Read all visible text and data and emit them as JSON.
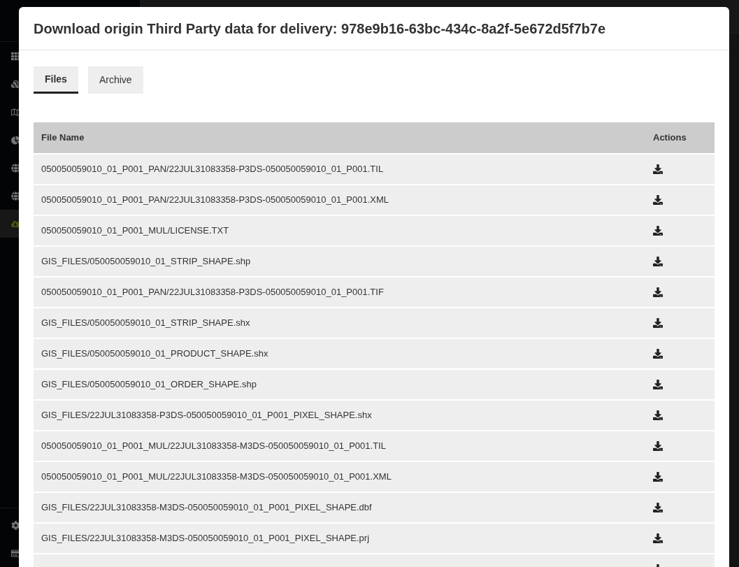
{
  "sidebar": {
    "items": [
      {
        "kind": "grid",
        "selected": false
      },
      {
        "kind": "cubes",
        "selected": false
      },
      {
        "kind": "map",
        "selected": false
      },
      {
        "kind": "pie",
        "selected": false
      },
      {
        "kind": "globe",
        "selected": false
      },
      {
        "kind": "globe",
        "selected": false
      },
      {
        "kind": "download",
        "selected": true
      }
    ],
    "bottom_items": [
      {
        "kind": "settings"
      },
      {
        "kind": "card"
      }
    ]
  },
  "modal": {
    "title": "Download origin Third Party data for delivery: 978e9b16-63bc-434c-8a2f-5e672d5f7b7e",
    "tabs": [
      {
        "label": "Files",
        "selected": true
      },
      {
        "label": "Archive",
        "selected": false
      }
    ],
    "table": {
      "columns": [
        "File Name",
        "Actions"
      ],
      "rows": [
        {
          "file_name": "050050059010_01_P001_PAN/22JUL31083358-P3DS-050050059010_01_P001.TIL"
        },
        {
          "file_name": "050050059010_01_P001_PAN/22JUL31083358-P3DS-050050059010_01_P001.XML"
        },
        {
          "file_name": "050050059010_01_P001_MUL/LICENSE.TXT"
        },
        {
          "file_name": "GIS_FILES/050050059010_01_STRIP_SHAPE.shp"
        },
        {
          "file_name": "050050059010_01_P001_PAN/22JUL31083358-P3DS-050050059010_01_P001.TIF"
        },
        {
          "file_name": "GIS_FILES/050050059010_01_STRIP_SHAPE.shx"
        },
        {
          "file_name": "GIS_FILES/050050059010_01_PRODUCT_SHAPE.shx"
        },
        {
          "file_name": "GIS_FILES/050050059010_01_ORDER_SHAPE.shp"
        },
        {
          "file_name": "GIS_FILES/22JUL31083358-P3DS-050050059010_01_P001_PIXEL_SHAPE.shx"
        },
        {
          "file_name": "050050059010_01_P001_MUL/22JUL31083358-M3DS-050050059010_01_P001.TIL"
        },
        {
          "file_name": "050050059010_01_P001_MUL/22JUL31083358-M3DS-050050059010_01_P001.XML"
        },
        {
          "file_name": "GIS_FILES/22JUL31083358-M3DS-050050059010_01_P001_PIXEL_SHAPE.dbf"
        },
        {
          "file_name": "GIS_FILES/22JUL31083358-M3DS-050050059010_01_P001_PIXEL_SHAPE.prj"
        },
        {}
      ]
    }
  }
}
